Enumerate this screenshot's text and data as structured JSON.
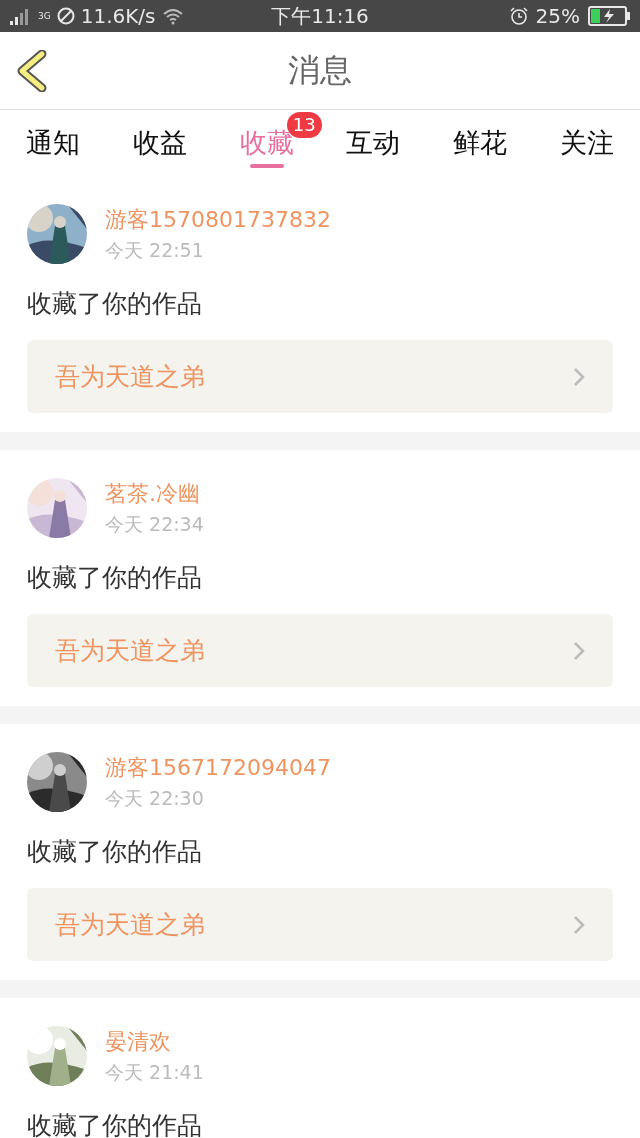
{
  "status_bar": {
    "speed": "11.6K/s",
    "time": "下午11:16",
    "battery": "25%",
    "network": "3G"
  },
  "header": {
    "title": "消息"
  },
  "tabs": [
    {
      "label": "通知",
      "selected": false
    },
    {
      "label": "收益",
      "selected": false
    },
    {
      "label": "收藏",
      "selected": true,
      "badge": "13"
    },
    {
      "label": "互动",
      "selected": false
    },
    {
      "label": "鲜花",
      "selected": false
    },
    {
      "label": "关注",
      "selected": false
    }
  ],
  "messages": [
    {
      "user": "游客1570801737832",
      "time": "今天 22:51",
      "text": "收藏了你的作品",
      "work": "吾为天道之弟"
    },
    {
      "user": "茗茶.冷幽",
      "time": "今天 22:34",
      "text": "收藏了你的作品",
      "work": "吾为天道之弟"
    },
    {
      "user": "游客1567172094047",
      "time": "今天 22:30",
      "text": "收藏了你的作品",
      "work": "吾为天道之弟"
    },
    {
      "user": "晏清欢",
      "time": "今天 21:41",
      "text": "收藏了你的作品"
    }
  ]
}
